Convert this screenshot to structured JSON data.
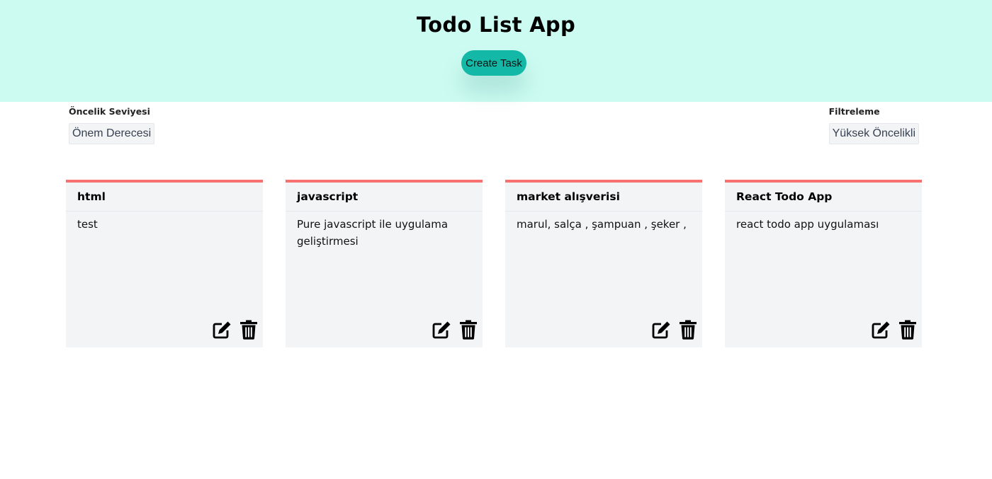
{
  "header": {
    "title": "Todo List App",
    "create_button": "Create Task"
  },
  "priority_control": {
    "label": "Öncelik Seviyesi",
    "selected": "Önem Derecesi"
  },
  "filter_control": {
    "label": "Filtreleme",
    "selected": "Yüksek Öncelikli"
  },
  "colors": {
    "header_bg": "#ccfbf1",
    "accent": "#14b8a6",
    "card_border_high_priority": "#f87171",
    "card_bg": "#f3f4f6"
  },
  "tasks": [
    {
      "title": "html",
      "description": "test",
      "icons": [
        "edit-icon",
        "trash-icon"
      ]
    },
    {
      "title": "javascript",
      "description": "Pure javascript ile uygulama geliştirmesi",
      "icons": [
        "edit-icon",
        "trash-icon"
      ]
    },
    {
      "title": "market alışverisi",
      "description": "marul, salça , şampuan , şeker ,",
      "icons": [
        "edit-icon",
        "trash-icon"
      ]
    },
    {
      "title": "React Todo App",
      "description": "react todo app uygulaması",
      "icons": [
        "edit-icon",
        "trash-icon"
      ]
    }
  ]
}
